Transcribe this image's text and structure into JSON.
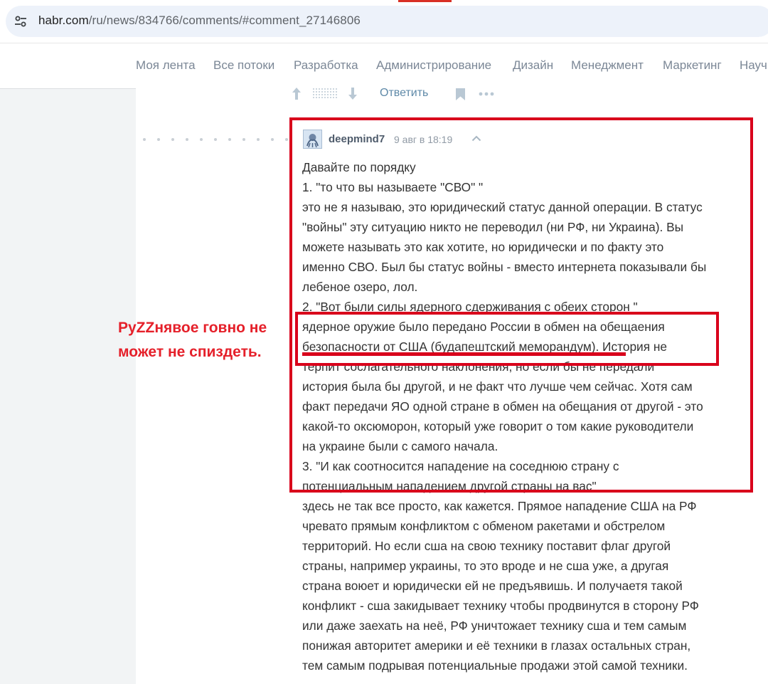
{
  "browser": {
    "url_host": "habr.com",
    "url_path": "/ru/news/834766/comments/#comment_27146806"
  },
  "nav": {
    "items": [
      "Моя лента",
      "Все потоки",
      "Разработка",
      "Администрирование",
      "Дизайн",
      "Менеджмент",
      "Маркетинг",
      "Науч"
    ]
  },
  "prev_comment_footer": {
    "reply_label": "Ответить"
  },
  "comment": {
    "username": "deepmind7",
    "timestamp": "9 авг в 18:19",
    "lines": [
      "Давайте по порядку",
      "1. \"то что вы называете \"СВО\" \"",
      "это не я называю, это юридический статус данной операции. В статус",
      "\"войны\" эту ситуацию никто не переводил (ни РФ, ни Украина). Вы",
      "можете называть это как хотите, но юридически и по факту это",
      "именно СВО. Был бы статус войны - вместо интернета показывали бы",
      "лебеное озеро, лол.",
      "2. \"Вот были силы ядерного сдерживания с обеих сторон \"",
      "ядерное оружие было передано России в обмен на обещаения",
      "безопасности от США (будапештский меморандум). История не",
      "терпит сослагательного наклонения, но если бы не передали",
      "история была бы другой, и не факт что лучше чем сейчас. Хотя сам",
      "факт передачи ЯО одной стране в обмен на обещания от другой - это",
      "какой-то оксюморон, который уже говорит о том какие руководители",
      "на украине были с самого начала.",
      "3. \"И как соотносится нападение на соседнюю страну с",
      "потенциальным нападением другой страны на вас\"",
      "здесь не так все просто, как кажется. Прямое нападение США на РФ",
      "чревато прямым конфликтом с обменом ракетами и обстрелом",
      "территорий. Но если сша на свою технику поставит флаг другой",
      "страны, например украины, то это вроде и не сша уже, а другая",
      "страна воюет и юридически ей не предъявишь. И получаетя такой",
      "конфликт - сша закидывает технику чтобы продвинутся в сторону РФ",
      "или даже заехать на неё, РФ уничтожает технику сша и тем самым",
      "понижая авторитет америки и её техники в глазах остальных стран,",
      "тем самым подрывая потенциальные продажи этой самой техники."
    ]
  },
  "annotation": {
    "line1": "PyZZнявое говно не",
    "line2": "может не спиздеть."
  },
  "colors": {
    "highlight_red": "#d9001b",
    "annotation_red": "#e5202a",
    "link_blue": "#5e89a8"
  }
}
